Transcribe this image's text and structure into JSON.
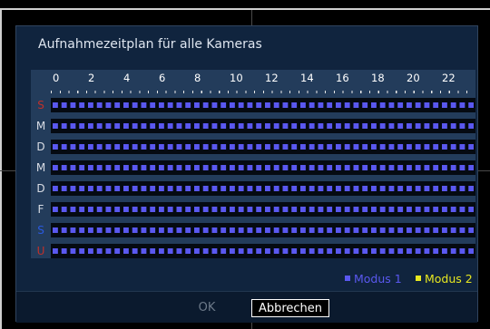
{
  "dialog": {
    "title": "Aufnahmezeitplan für alle Kameras"
  },
  "schedule": {
    "hour_labels": [
      "0",
      "2",
      "4",
      "6",
      "8",
      "10",
      "12",
      "14",
      "16",
      "18",
      "20",
      "22"
    ],
    "rows": [
      {
        "label": "S",
        "color": "#c0302a"
      },
      {
        "label": "M",
        "color": "#d8dce4"
      },
      {
        "label": "D",
        "color": "#d8dce4"
      },
      {
        "label": "M",
        "color": "#d8dce4"
      },
      {
        "label": "D",
        "color": "#d8dce4"
      },
      {
        "label": "F",
        "color": "#d8dce4"
      },
      {
        "label": "S",
        "color": "#2a5ae0"
      },
      {
        "label": "U",
        "color": "#c0302a"
      }
    ],
    "slot_color": "#5a58f0"
  },
  "legend": {
    "mode1_label": "Modus 1",
    "mode1_color": "#5a58f0",
    "mode2_label": "Modus 2",
    "mode2_color": "#e8e820"
  },
  "buttons": {
    "ok_label": "OK",
    "cancel_label": "Abbrechen"
  }
}
